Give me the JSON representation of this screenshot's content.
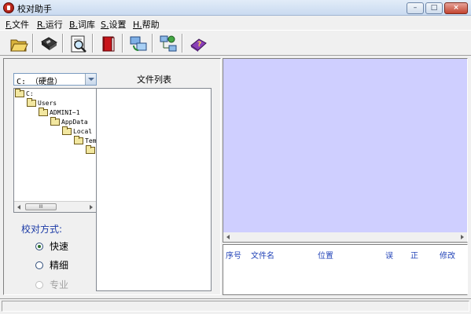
{
  "window": {
    "title": "校对助手",
    "min_glyph": "–",
    "max_glyph": "□",
    "close_glyph": "×"
  },
  "menu": [
    {
      "key": "F.",
      "label": "文件"
    },
    {
      "key": "R.",
      "label": "运行"
    },
    {
      "key": "B.",
      "label": "词库"
    },
    {
      "key": "S.",
      "label": "设置"
    },
    {
      "key": "H.",
      "label": "帮助"
    }
  ],
  "toolbar": {
    "icons": [
      "open-folder-icon",
      "save-disk-icon",
      "check-document-icon",
      "red-book-icon",
      "network-compare-icon",
      "network-settings-icon",
      "help-book-icon"
    ]
  },
  "left": {
    "drive": "C: （硬盘）",
    "file_list_title": "文件列表",
    "tree": [
      "C:",
      "Users",
      "ADMINI~1",
      "AppData",
      "Local",
      "Tem",
      ""
    ],
    "scroll_thumb": "III",
    "mode_label": "校对方式:",
    "modes": [
      {
        "label": "快速",
        "checked": true,
        "disabled": false
      },
      {
        "label": "精细",
        "checked": false,
        "disabled": false
      },
      {
        "label": "专业",
        "checked": false,
        "disabled": true
      }
    ]
  },
  "results": {
    "columns": [
      "序号",
      "文件名",
      "位置",
      "误",
      "正",
      "修改"
    ]
  },
  "colors": {
    "preview_bg": "#cfcfff",
    "header_text": "#2344b8",
    "mode_label": "#1b3aa6"
  }
}
